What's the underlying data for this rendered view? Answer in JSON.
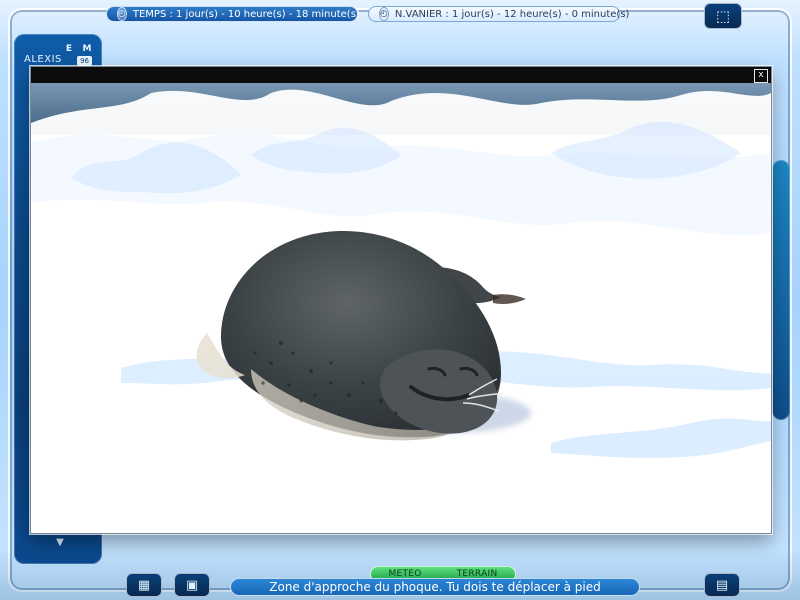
{
  "top_bar": {
    "time_text": "TEMPS : 1 jour(s) - 10 heure(s) - 18 minute(s)",
    "vanier_text": "N.VANIER : 1 jour(s) - 12 heure(s) - 0 minute(s)"
  },
  "left_panel": {
    "player_name": "ALEXIS",
    "letters": [
      "E",
      "M"
    ],
    "badge": "96"
  },
  "footer": {
    "segment": [
      "METEO",
      "TERRAIN"
    ],
    "message": "Zone d'approche du phoque. Tu dois te déplacer à pied"
  },
  "icons": {
    "time_icon": "clock-icon",
    "vanier_icon": "clock-icon",
    "close_icon": "close-icon",
    "top_right_icon": "square-arrow-icon",
    "calendar_icon": "calendar-icon",
    "save_icon": "save-icon",
    "doc_icon": "document-icon"
  }
}
